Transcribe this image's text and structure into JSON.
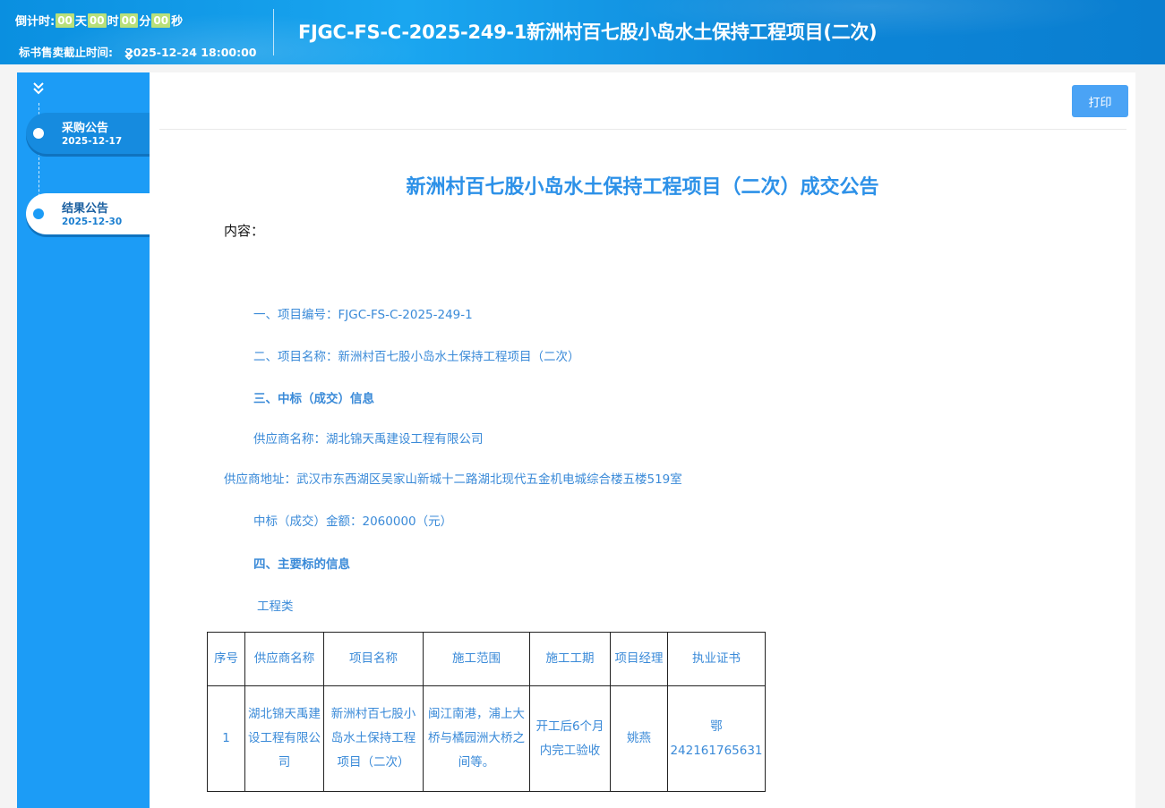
{
  "header": {
    "countdown_label": "倒计时:",
    "countdown": [
      {
        "value": "00",
        "unit": "天"
      },
      {
        "value": "00",
        "unit": "时"
      },
      {
        "value": "00",
        "unit": "分"
      },
      {
        "value": "00",
        "unit": "秒"
      }
    ],
    "deadline_label": "标书售卖截止时间:",
    "deadline_value": "2025-12-24 18:00:00",
    "title": "FJGC-FS-C-2025-249-1新洲村百七股小岛水土保持工程项目(二次)"
  },
  "sidebar": {
    "items": [
      {
        "label": "采购公告",
        "date": "2025-12-17",
        "active": false
      },
      {
        "label": "结果公告",
        "date": "2025-12-30",
        "active": true
      }
    ]
  },
  "main": {
    "print_label": "打印",
    "doc_title": "新洲村百七股小岛水土保持工程项目（二次）成交公告",
    "content_label": "内容：",
    "lines": [
      "一、项目编号：FJGC-FS-C-2025-249-1",
      "二、项目名称：新洲村百七股小岛水土保持工程项目（二次）",
      "三、中标（成交）信息",
      "供应商名称：湖北锦天禹建设工程有限公司",
      "供应商地址：武汉市东西湖区吴家山新城十二路湖北现代五金机电城综合楼五楼519室",
      "中标（成交）金额：2060000（元）",
      "四、主要标的信息",
      "工程类"
    ],
    "table": {
      "headers": [
        "序号",
        "供应商名称",
        "项目名称",
        "施工范围",
        "施工工期",
        "项目经理",
        "执业证书"
      ],
      "rows": [
        [
          "1",
          "湖北锦天禹建设工程有限公司",
          "新洲村百七股小岛水土保持工程项目（二次）",
          "闽江南港，浦上大桥与橘园洲大桥之间等。",
          "开工后6个月内完工验收",
          "姚燕",
          "鄂242161765631"
        ]
      ]
    }
  }
}
